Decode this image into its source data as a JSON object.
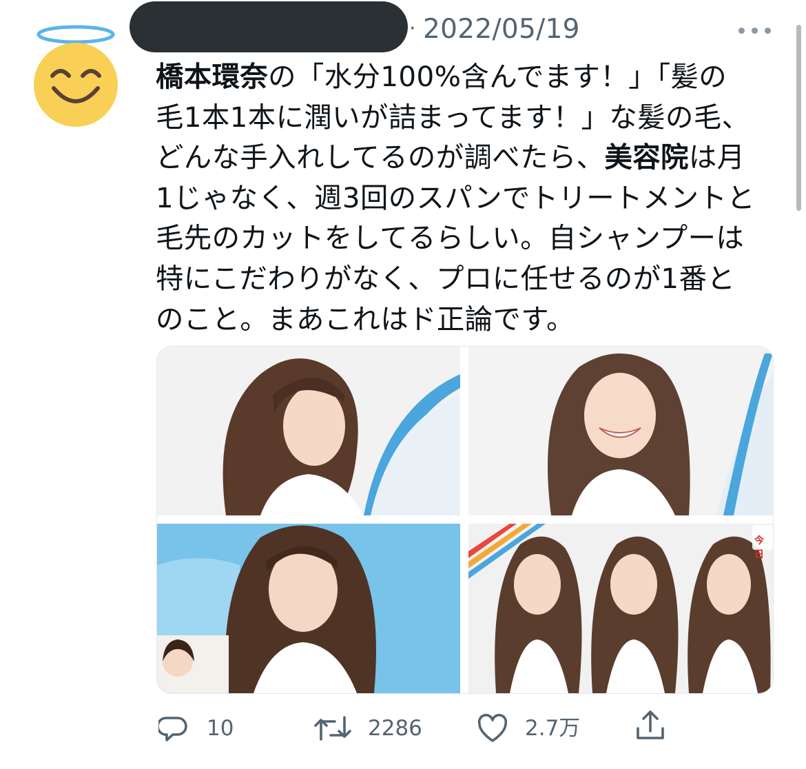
{
  "header": {
    "timestamp": "2022/05/19",
    "separator": "·"
  },
  "icons": {
    "avatar": "halo-smiling-face-emoji",
    "more": "more-horizontal-icon",
    "reply": "reply-icon",
    "retweet": "retweet-icon",
    "like": "heart-icon",
    "share": "share-icon"
  },
  "tweet": {
    "line1_bold": "橋本環奈",
    "line1_text": "の「水分100%含んでます！」「髪の",
    "line2": "毛1本1本に潤いが詰まってます！」な髪の毛、",
    "line3_text": "どんな手入れしてるのが調べたら、",
    "line3_bold": "美容院",
    "line3_tail": "は月",
    "line4": "1じゃなく、週3回のスパンでトリートメントと",
    "line5": "毛先のカットをしてるらしい。自シャンプーは",
    "line6": "特にこだわりがなく、プロに任せるのが1番と",
    "line7": "のこと。まあこれはド正論です。"
  },
  "media": {
    "overlay_badge": "今日"
  },
  "actions": {
    "replies": "10",
    "retweets": "2286",
    "likes": "2.7万"
  },
  "colors": {
    "text": "#0f1419",
    "secondary": "#536471",
    "redaction": "#2a3033"
  }
}
